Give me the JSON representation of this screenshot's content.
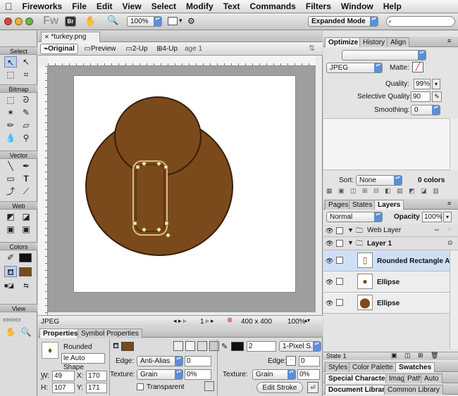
{
  "menubar": {
    "apple": "",
    "items": [
      "Fireworks",
      "File",
      "Edit",
      "View",
      "Select",
      "Modify",
      "Text",
      "Commands",
      "Filters",
      "Window",
      "Help"
    ]
  },
  "apptoolbar": {
    "fw_logo": "Fw",
    "br_label": "Br",
    "zoom": "100%",
    "workspace": "Expanded Mode"
  },
  "tools": {
    "sections": [
      "Select",
      "Bitmap",
      "Vector",
      "Web",
      "Colors",
      "View"
    ]
  },
  "document": {
    "tab": "*turkey.png",
    "views": [
      "Original",
      "Preview",
      "2-Up",
      "4-Up"
    ],
    "page_label": "age 1",
    "status": {
      "format": "JPEG",
      "frame": "1",
      "size": "400 x 400",
      "zoom": "100%"
    }
  },
  "properties": {
    "tabs": [
      "Properties",
      "Symbol Properties"
    ],
    "object_type": "Rounded",
    "object_desc": "le Auto Shape",
    "w": "49",
    "x": "170",
    "h": "107",
    "y": "171",
    "w_label": "W:",
    "x_label": "X:",
    "h_label": "H:",
    "y_label": "Y:",
    "edge_label": "Edge:",
    "edge": "Anti-Alias",
    "edge_val": "0",
    "texture_label": "Texture:",
    "texture": "Grain",
    "texture_pct": "0%",
    "transparent": "Transparent",
    "stroke_size": "2",
    "stroke_type": "1-Pixel S...",
    "stroke_edge_label": "Edge:",
    "stroke_edge": "0",
    "stroke_texture_label": "Texture:",
    "stroke_texture": "Grain",
    "stroke_texture_pct": "0%",
    "edit_stroke": "Edit Stroke",
    "fill_color": "#7a4a1c",
    "stroke_color": "#111111"
  },
  "optimize": {
    "tabs": [
      "Optimize",
      "History",
      "Align"
    ],
    "format": "JPEG",
    "matte_label": "Matte:",
    "quality_label": "Quality:",
    "quality": "99%",
    "sel_quality_label": "Selective Quality:",
    "sel_quality": "90",
    "smoothing_label": "Smoothing:",
    "smoothing": "0",
    "sort_label": "Sort:",
    "sort": "None",
    "colors": "0 colors"
  },
  "layers": {
    "tabs": [
      "Pages",
      "States",
      "Layers"
    ],
    "blend": "Normal",
    "opacity_label": "Opacity",
    "opacity": "100%",
    "web_layer": "Web Layer",
    "layer1": "Layer 1",
    "objects": [
      "Rounded Rectangle A...",
      "Ellipse",
      "Ellipse"
    ],
    "state": "State 1"
  },
  "bottom_tabs": {
    "row1": [
      "Styles",
      "Color Palette",
      "Swatches"
    ],
    "row2": [
      "Special Characters",
      "Imag",
      "Path",
      "Auto"
    ],
    "row3": [
      "Document Library",
      "Common Library"
    ]
  },
  "colors": {
    "brown": "#7a4a1c",
    "brown_dark": "#5b3410",
    "selection": "#cfe0f6",
    "accent": "#5a8fd8"
  }
}
